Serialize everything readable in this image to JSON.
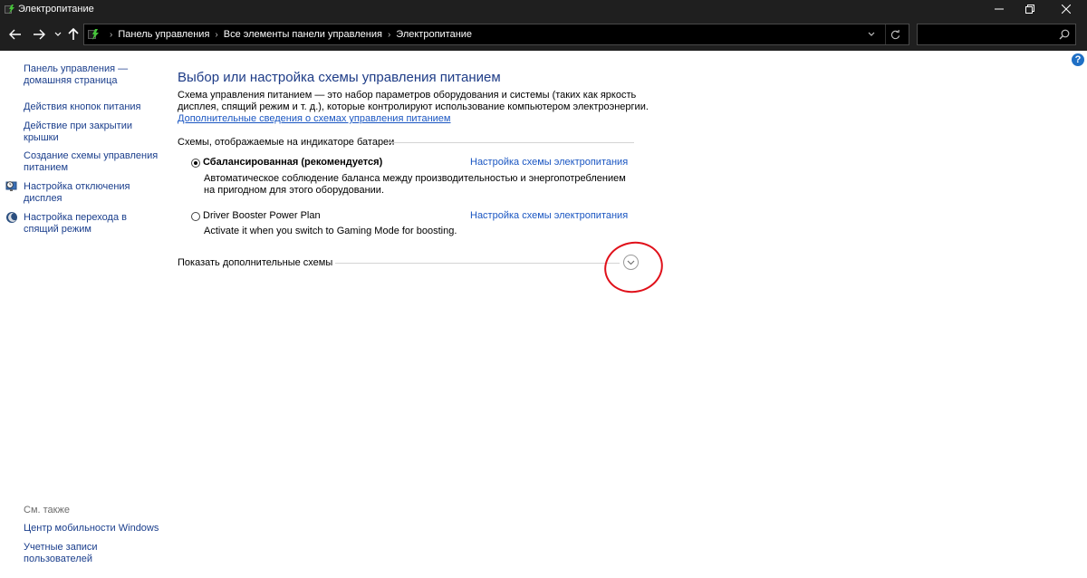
{
  "window": {
    "title": "Электропитание",
    "minimize_icon": "minimize-icon",
    "restore_icon": "restore-icon",
    "close_icon": "close-icon"
  },
  "address_bar": {
    "crumbs": [
      "Панель управления",
      "Все элементы панели управления",
      "Электропитание"
    ],
    "search_placeholder": ""
  },
  "sidebar": {
    "items": [
      {
        "label": "Панель управления —\nдомашняя страница"
      },
      {
        "label": "Действия кнопок питания"
      },
      {
        "label": "Действие при закрытии\nкрышки"
      },
      {
        "label": "Создание схемы управления\nпитанием"
      },
      {
        "label": "Настройка отключения\nдисплея",
        "icon": "monitor-clock-icon"
      },
      {
        "label": "Настройка перехода в\nспящий режим",
        "icon": "moon-icon"
      }
    ],
    "see_also": "См. также",
    "see_also_items": [
      {
        "label": "Центр мобильности Windows"
      },
      {
        "label": "Учетные записи\nпользователей"
      }
    ]
  },
  "main": {
    "title": "Выбор или настройка схемы управления питанием",
    "description": "Схема управления питанием — это набор параметров оборудования и системы (таких как яркость дисплея, спящий режим и т. д.), которые контролируют использование компьютером электроэнергии.",
    "more_info_link": "Дополнительные сведения о схемах управления питанием",
    "section_header": "Схемы, отображаемые на индикаторе батареи",
    "plans": [
      {
        "name": "Сбалансированная (рекомендуется)",
        "selected": true,
        "description": "Автоматическое соблюдение баланса между производительностью и энергопотреблением на пригодном для этого оборудовании.",
        "link": "Настройка схемы электропитания"
      },
      {
        "name": "Driver Booster Power Plan",
        "selected": false,
        "description": "Activate it when you switch to Gaming Mode for boosting.",
        "link": "Настройка схемы электропитания"
      }
    ],
    "show_more": "Показать дополнительные схемы"
  },
  "colors": {
    "titlebar_bg": "#1f1f1f",
    "link": "#1a56c2",
    "heading": "#1e3c87",
    "annotation": "#e0101a"
  }
}
